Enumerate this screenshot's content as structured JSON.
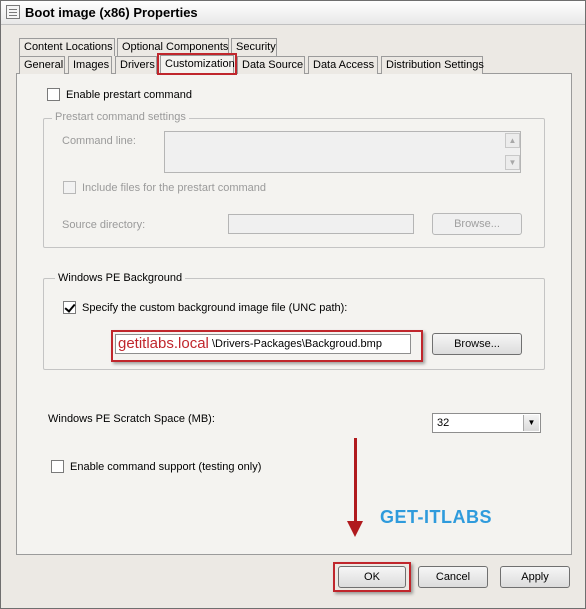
{
  "window": {
    "title": "Boot image (x86) Properties",
    "close_glyph": "✕"
  },
  "tabs_row1": [
    {
      "label": "Content Locations"
    },
    {
      "label": "Optional Components"
    },
    {
      "label": "Security"
    }
  ],
  "tabs_row2": [
    {
      "label": "General"
    },
    {
      "label": "Images"
    },
    {
      "label": "Drivers"
    },
    {
      "label": "Customization",
      "active": true
    },
    {
      "label": "Data Source"
    },
    {
      "label": "Data Access"
    },
    {
      "label": "Distribution Settings"
    }
  ],
  "prestart": {
    "enable_label": "Enable prestart command",
    "enable_checked": false,
    "group_title": "Prestart command settings",
    "command_line_label": "Command line:",
    "include_files_label": "Include files for the prestart command",
    "source_dir_label": "Source directory:",
    "browse_label": "Browse..."
  },
  "winpe_background": {
    "group_title": "Windows PE Background",
    "specify_label": "Specify the custom background image file (UNC path):",
    "specify_checked": true,
    "path_prefix": "getitlabs.local",
    "path_value": "\\Drivers-Packages\\Backgroud.bmp",
    "browse_label": "Browse..."
  },
  "scratch": {
    "label": "Windows PE Scratch Space (MB):",
    "value": "32"
  },
  "command_support": {
    "label": "Enable command support (testing only)",
    "checked": false
  },
  "buttons": {
    "ok": "OK",
    "cancel": "Cancel",
    "apply": "Apply"
  },
  "annotation": {
    "watermark": "GET-ITLABS",
    "highlight_color": "#c0262c",
    "arrow_color": "#b01a1e"
  },
  "icons": {
    "scroll_up": "▲",
    "scroll_down": "▼",
    "dropdown": "▼"
  }
}
